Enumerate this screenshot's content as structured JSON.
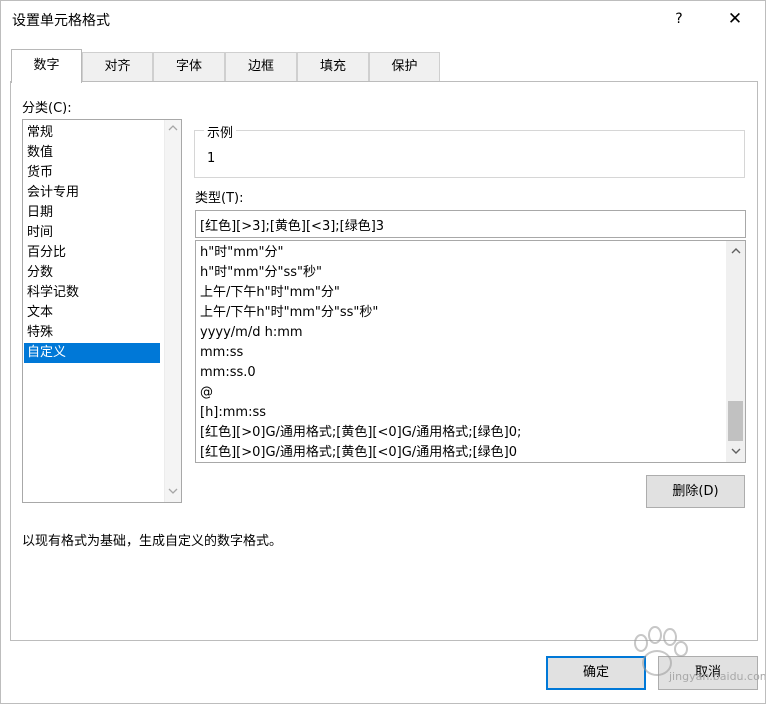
{
  "window": {
    "title": "设置单元格格式",
    "help_glyph": "?",
    "close_glyph": "✕"
  },
  "tabs": [
    "数字",
    "对齐",
    "字体",
    "边框",
    "填充",
    "保护"
  ],
  "active_tab": "数字",
  "category": {
    "label": "分类(C):",
    "items": [
      "常规",
      "数值",
      "货币",
      "会计专用",
      "日期",
      "时间",
      "百分比",
      "分数",
      "科学记数",
      "文本",
      "特殊",
      "自定义"
    ],
    "selected": "自定义"
  },
  "sample": {
    "label": "示例",
    "value": "1"
  },
  "type": {
    "label": "类型(T):",
    "value": "[红色][>3];[黄色][<3];[绿色]3"
  },
  "format_list": [
    "h\"时\"mm\"分\"",
    "h\"时\"mm\"分\"ss\"秒\"",
    "上午/下午h\"时\"mm\"分\"",
    "上午/下午h\"时\"mm\"分\"ss\"秒\"",
    "yyyy/m/d h:mm",
    "mm:ss",
    "mm:ss.0",
    "@",
    "[h]:mm:ss",
    "[红色][>0]G/通用格式;[黄色][<0]G/通用格式;[绿色]0;",
    "[红色][>0]G/通用格式;[黄色][<0]G/通用格式;[绿色]0"
  ],
  "buttons": {
    "delete": "删除(D)",
    "ok": "确定",
    "cancel": "取消"
  },
  "description": "以现有格式为基础，生成自定义的数字格式。",
  "watermark": {
    "text": "jingyan.baidu.com"
  },
  "colors": {
    "selection": "#0078d7",
    "primary_border": "#0078d7"
  },
  "icons": {
    "up": "scroll-up-arrow-icon",
    "down": "scroll-down-arrow-icon"
  }
}
